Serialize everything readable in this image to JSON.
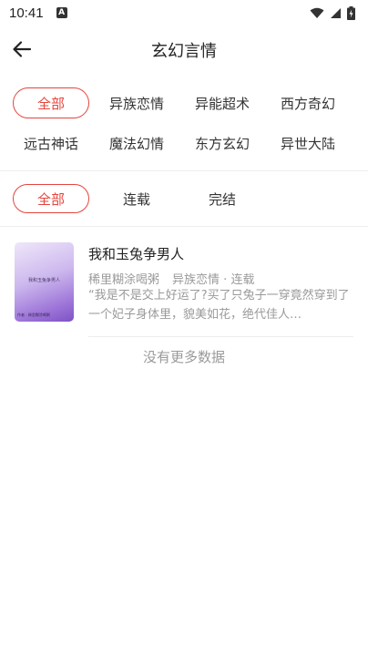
{
  "status_bar": {
    "time": "10:41",
    "notification_letter": "A",
    "icons": [
      "wifi-icon",
      "signal-icon",
      "battery-icon"
    ]
  },
  "header": {
    "back_icon": "arrow-left-icon",
    "title": "玄幻言情"
  },
  "categories": [
    {
      "label": "全部",
      "active": true
    },
    {
      "label": "异族恋情",
      "active": false
    },
    {
      "label": "异能超术",
      "active": false
    },
    {
      "label": "西方奇幻",
      "active": false
    },
    {
      "label": "远古神话",
      "active": false
    },
    {
      "label": "魔法幻情",
      "active": false
    },
    {
      "label": "东方玄幻",
      "active": false
    },
    {
      "label": "异世大陆",
      "active": false
    }
  ],
  "status_filters": [
    {
      "label": "全部",
      "active": true
    },
    {
      "label": "连载",
      "active": false
    },
    {
      "label": "完结",
      "active": false
    }
  ],
  "books": [
    {
      "title": "我和玉兔争男人",
      "author": "稀里糊涂喝粥",
      "category": "异族恋情",
      "status": "连载",
      "description": "“我是不是交上好运了?买了只兔子一穿竟然穿到了一个妃子身体里，貌美如花，绝代佳人…",
      "cover_title": "我和玉兔争男人",
      "cover_footer": "作者 · 稀里糊涂喝粥"
    }
  ],
  "footer": {
    "no_more_text": "没有更多数据"
  },
  "colors": {
    "accent": "#e5443d",
    "muted_text": "#9a9a9a",
    "divider": "#eeeeee"
  }
}
